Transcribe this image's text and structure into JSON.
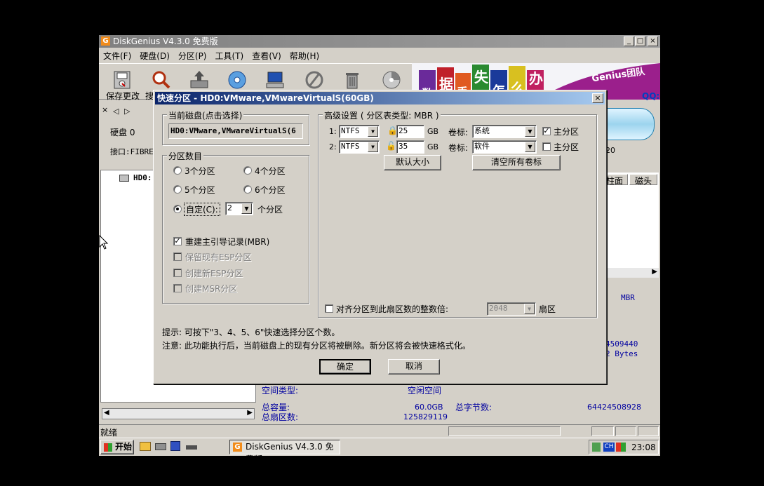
{
  "app": {
    "title": "DiskGenius V4.3.0 免费版",
    "icon_letter": "G"
  },
  "menu": [
    "文件(F)",
    "硬盘(D)",
    "分区(P)",
    "工具(T)",
    "查看(V)",
    "帮助(H)"
  ],
  "toolbar": {
    "save_label": "保存更改",
    "search_label_partial": "搜"
  },
  "banner": {
    "chars": [
      "数",
      "据",
      "丢",
      "失",
      "怎",
      "么",
      "办"
    ],
    "brand": "Genius团队",
    "qq": "QQ:"
  },
  "left_panel": {
    "disk_label": "硬盘 0",
    "interface_label": "接口:FIBRE",
    "tree_item": "HD0:"
  },
  "right_panel": {
    "col_cylinder": "柱面",
    "col_head": "磁头",
    "partial_num": "20",
    "mbr": "MBR",
    "sectors_partial": "4509440",
    "bytes_partial": "2 Bytes",
    "space_type_label": "空间类型:",
    "space_type_value": "空闲空间",
    "total_capacity_label": "总容量:",
    "total_capacity_value": "60.0GB",
    "total_bytes_label": "总字节数:",
    "total_bytes_value": "64424508928",
    "total_sectors_label": "总扇区数:",
    "total_sectors_value": "125829119"
  },
  "status": {
    "ready": "就绪"
  },
  "taskbar": {
    "start": "开始",
    "task": "DiskGenius V4.3.0 免费版",
    "ime": "CH",
    "time": "23:08"
  },
  "dialog": {
    "title": "快速分区 - HD0:VMware,VMwareVirtualS(60GB)",
    "current_disk_group": "当前磁盘(点击选择)",
    "current_disk_value": "HD0:VMware,VMwareVirtualS(6",
    "count_group": "分区数目",
    "options": [
      "3个分区",
      "4个分区",
      "5个分区",
      "6个分区"
    ],
    "custom_label": "自定(C):",
    "custom_value": "2",
    "custom_suffix": "个分区",
    "checks": [
      {
        "label": "重建主引导记录(MBR)",
        "checked": true,
        "disabled": false
      },
      {
        "label": "保留现有ESP分区",
        "checked": false,
        "disabled": true
      },
      {
        "label": "创建新ESP分区",
        "checked": false,
        "disabled": true
      },
      {
        "label": "创建MSR分区",
        "checked": false,
        "disabled": true
      }
    ],
    "advanced_group": "高级设置 ( 分区表类型: MBR )",
    "rows": [
      {
        "num": "1:",
        "fs": "NTFS",
        "size": "25",
        "unit": "GB",
        "vol_label": "卷标:",
        "vol_value": "系统",
        "primary_label": "主分区",
        "primary": true
      },
      {
        "num": "2:",
        "fs": "NTFS",
        "size": "35",
        "unit": "GB",
        "vol_label": "卷标:",
        "vol_value": "软件",
        "primary_label": "主分区",
        "primary": false
      }
    ],
    "default_size_btn": "默认大小",
    "clear_labels_btn": "清空所有卷标",
    "align_label": "对齐分区到此扇区数的整数倍:",
    "align_value": "2048",
    "align_unit": "扇区",
    "hint": "提示: 可按下\"3、4、5、6\"快速选择分区个数。",
    "note": "注意: 此功能执行后，当前磁盘上的现有分区将被删除。新分区将会被快速格式化。",
    "ok": "确定",
    "cancel": "取消"
  }
}
